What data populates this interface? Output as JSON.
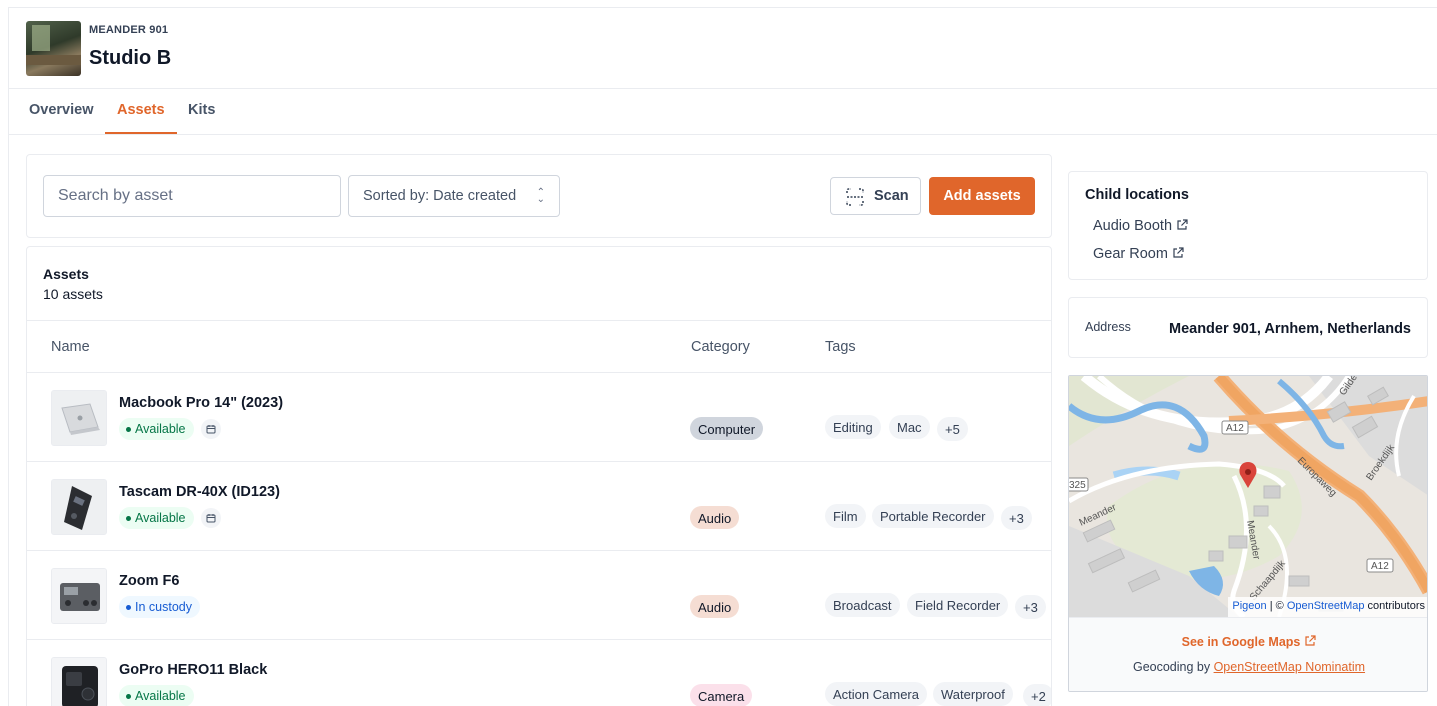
{
  "header": {
    "eyebrow": "MEANDER 901",
    "title": "Studio B"
  },
  "tabs": [
    {
      "label": "Overview"
    },
    {
      "label": "Assets",
      "active": true
    },
    {
      "label": "Kits"
    }
  ],
  "toolbar": {
    "search_placeholder": "Search by asset",
    "sort_label": "Sorted by: Date created",
    "scan_label": "Scan",
    "add_label": "Add assets"
  },
  "assets": {
    "title": "Assets",
    "count": "10 assets",
    "columns": [
      "Name",
      "Category",
      "Tags"
    ],
    "rows": [
      {
        "name": "Macbook Pro 14\" (2023)",
        "status": "Available",
        "category": "Computer",
        "tags": [
          "Editing",
          "Mac"
        ],
        "more": "+5"
      },
      {
        "name": "Tascam DR-40X (ID123)",
        "status": "Available",
        "category": "Audio",
        "tags": [
          "Film",
          "Portable Recorder"
        ],
        "more": "+3"
      },
      {
        "name": "Zoom F6",
        "status": "In custody",
        "category": "Audio",
        "tags": [
          "Broadcast",
          "Field Recorder"
        ],
        "more": "+3"
      },
      {
        "name": "GoPro HERO11 Black",
        "status": "Available",
        "category": "Camera",
        "tags": [
          "Action Camera",
          "Waterproof"
        ],
        "more": "+2"
      }
    ]
  },
  "sidebar": {
    "child_title": "Child locations",
    "children": [
      "Audio Booth",
      "Gear Room"
    ],
    "address_label": "Address",
    "address_value": "Meander 901, Arnhem, Netherlands",
    "map": {
      "labels": [
        "A12",
        "A12",
        "325",
        "Meander",
        "Europaweg",
        "Broekdijk",
        "Meander",
        "Schaapdijk",
        "Gilde"
      ],
      "attribution_pigeon": "Pigeon",
      "attribution_sep": " | © ",
      "attribution_osm": "OpenStreetMap",
      "attribution_tail": " contributors"
    },
    "gmaps_link": "See in Google Maps",
    "geocoding_prefix": "Geocoding by ",
    "geocoding_link": "OpenStreetMap Nominatim"
  },
  "colors": {
    "accent": "#e0662b",
    "computer": "#d0d5dd",
    "audio": "#f5ddd3",
    "camera": "#fbe0ea"
  }
}
